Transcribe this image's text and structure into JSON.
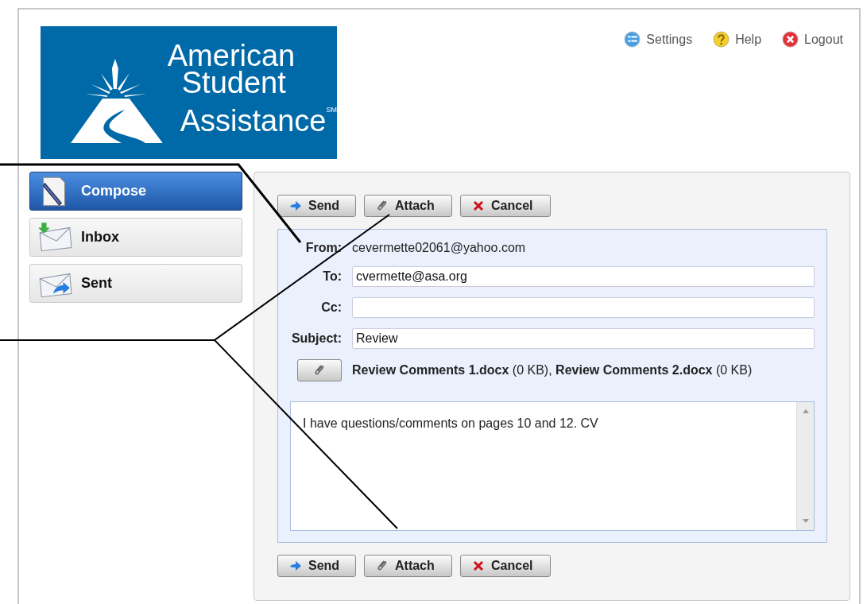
{
  "logo": {
    "lines": [
      "American",
      "Student",
      "Assistance$^{SM}$"
    ]
  },
  "top_links": [
    {
      "kind": "settings",
      "label": "Settings"
    },
    {
      "kind": "help",
      "label": "Help"
    },
    {
      "kind": "logout",
      "label": "Logout"
    }
  ],
  "sidebar": {
    "items": [
      {
        "kind": "compose",
        "label": "Compose",
        "selected": true
      },
      {
        "kind": "inbox",
        "label": "Inbox",
        "selected": false
      },
      {
        "kind": "sent",
        "label": "Sent",
        "selected": false
      }
    ]
  },
  "toolbar_top": [
    {
      "kind": "send",
      "label": "Send"
    },
    {
      "kind": "attach",
      "label": "Attach"
    },
    {
      "kind": "cancel",
      "label": "Cancel"
    }
  ],
  "form": {
    "from_label": "From:",
    "from": "cevermette02061@yahoo.com",
    "fields": [
      {
        "label": "To:",
        "value": "cvermette@asa.org"
      },
      {
        "label": "Cc:"
      },
      {
        "label": "Subject:",
        "value": "Review"
      }
    ],
    "attachments": "**Review Comments 1.docx** (0 KB), **Review Comments 2.docx** (0 KB)",
    "body": "I have questions/comments on pages 10 and 12. CV"
  },
  "toolbar_bottom": [
    {
      "kind": "send",
      "label": "Send"
    },
    {
      "kind": "attach",
      "label": "Attach"
    },
    {
      "kind": "cancel",
      "label": "Cancel"
    }
  ]
}
